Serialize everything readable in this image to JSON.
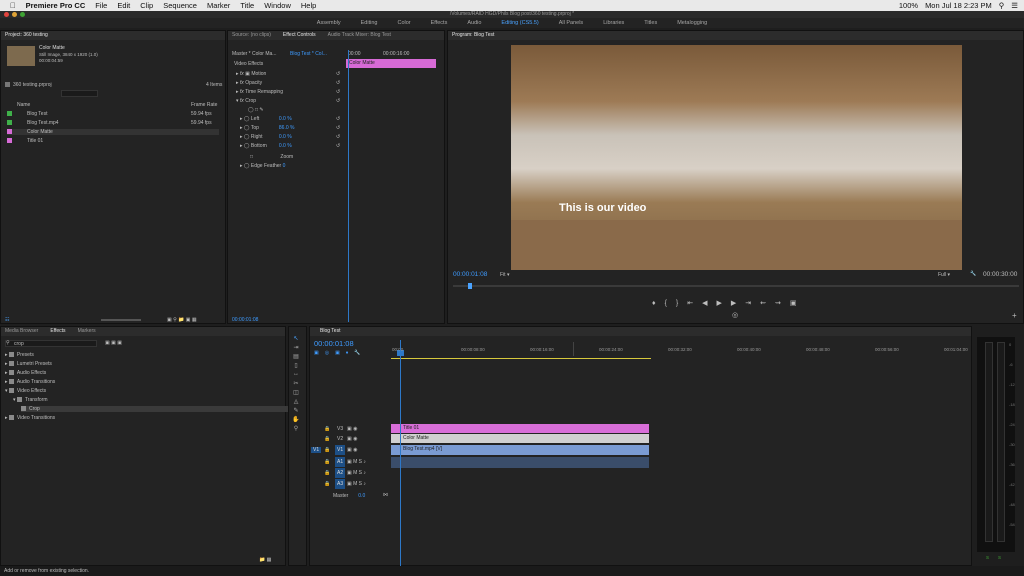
{
  "macbar": {
    "app": "Premiere Pro CC",
    "menus": [
      "File",
      "Edit",
      "Clip",
      "Sequence",
      "Marker",
      "Title",
      "Window",
      "Help"
    ],
    "percent": "100%",
    "clock": "Mon Jul 18  2:23 PM"
  },
  "titlebar": "/Volumes/RAID HGD/Phils Blog post/360 testing.prproj *",
  "workspaces": [
    "Assembly",
    "Editing",
    "Color",
    "Effects",
    "Audio",
    "Editing (CS5.5)",
    "All Panels",
    "Libraries",
    "Titles",
    "Metalogging"
  ],
  "project": {
    "tab": "Project: 360 testing",
    "thumb_name": "Color Matte",
    "thumb_info": "Still Image, 3840 x 1920 (1.0)",
    "thumb_duration": "00:00:04:59",
    "file": "360 testing.prproj",
    "count": "4 Items",
    "col_name": "Name",
    "col_rate": "Frame Rate",
    "items": [
      {
        "name": "Blog Test",
        "rate": "59.94 fps",
        "color": "#3fb04a"
      },
      {
        "name": "Blog Test.mp4",
        "rate": "59.94 fps",
        "color": "#3fb04a"
      },
      {
        "name": "Color Matte",
        "rate": "",
        "color": "#d66bd6"
      },
      {
        "name": "Title 01",
        "rate": "",
        "color": "#d66bd6"
      }
    ]
  },
  "effectcontrols": {
    "tabs": [
      "Source: (no clips)",
      "Effect Controls",
      "Audio Track Mixer: Blog Test"
    ],
    "master": "Master * Color Ma...",
    "seq": "Blog Test * Col...",
    "time_a": "00:00",
    "time_b": "00:00:16:00",
    "clip": "Color Matte",
    "section": "Video Effects",
    "effects": [
      "Motion",
      "Opacity",
      "Time Remapping",
      "Crop"
    ],
    "params": [
      {
        "name": "Left",
        "value": "0.0 %"
      },
      {
        "name": "Top",
        "value": "86.0 %"
      },
      {
        "name": "Right",
        "value": "0.0 %"
      },
      {
        "name": "Bottom",
        "value": "0.0 %"
      }
    ],
    "zoom": "Zoom",
    "feather": "Edge Feather",
    "feather_val": "0",
    "timecode": "00:00:01:08"
  },
  "program": {
    "tab": "Program: Blog Test",
    "overlay": "This is our video",
    "timecode": "00:00:01:08",
    "fit": "Fit",
    "quality": "Full",
    "duration": "00:00:30:00"
  },
  "effects": {
    "tabs": [
      "Media Browser",
      "Effects",
      "Markers"
    ],
    "search": "crop",
    "tree": [
      "Presets",
      "Lumetri Presets",
      "Audio Effects",
      "Audio Transitions",
      "Video Effects",
      "Transform",
      "Crop",
      "Video Transitions"
    ]
  },
  "timeline": {
    "tab": "Blog Test",
    "timecode": "00:00:01:08",
    "ruler": [
      "00:00",
      "00:00:08:00",
      "00:00:16:00",
      "00:00:24:00",
      "00:00:32:00",
      "00:00:40:00",
      "00:00:48:00",
      "00:00:56:00",
      "00:01:04:00"
    ],
    "tracks": [
      "V3",
      "V2",
      "V1",
      "A1",
      "A2",
      "A3"
    ],
    "master": "Master",
    "master_val": "0.0",
    "clips": {
      "title": "Title 01",
      "matte": "Color Matte",
      "video": "Blog Test.mp4 [V]"
    }
  },
  "meter": {
    "ticks": [
      "0",
      "-6",
      "-12",
      "-18",
      "-24",
      "-30",
      "-36",
      "-42",
      "-48",
      "-54"
    ],
    "sm": [
      "S",
      "S"
    ]
  },
  "status": "Add or remove from existing selection."
}
